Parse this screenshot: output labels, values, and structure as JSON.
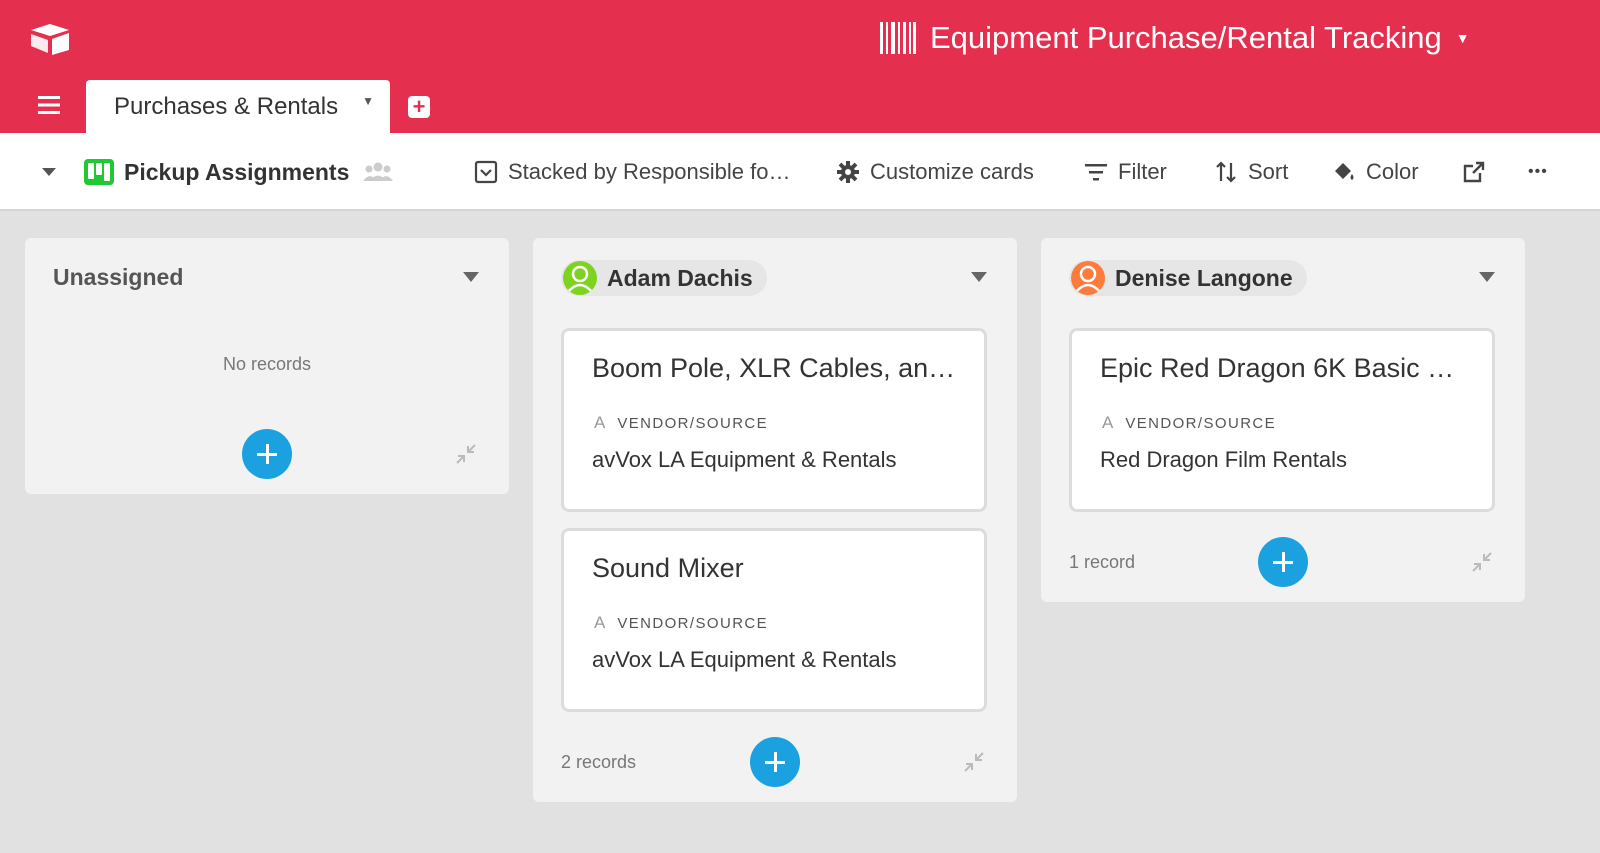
{
  "app": {
    "base_title": "Equipment Purchase/Rental Tracking",
    "brand_color": "#e52f4f"
  },
  "tabs": [
    {
      "label": "Purchases & Rentals",
      "active": true
    }
  ],
  "viewbar": {
    "view_name": "Pickup Assignments",
    "stacked_by": "Stacked by Responsible fo…",
    "customize": "Customize cards",
    "filter": "Filter",
    "sort": "Sort",
    "color": "Color",
    "more": "•••"
  },
  "columns": [
    {
      "title": "Unassigned",
      "empty_text": "No records",
      "cards": []
    },
    {
      "title": "Adam Dachis",
      "avatar_color": "#7ed321",
      "count_text": "2 records",
      "cards": [
        {
          "title": "Boom Pole, XLR Cables, an…",
          "field_label": "VENDOR/SOURCE",
          "field_value": "avVox LA Equipment & Rentals"
        },
        {
          "title": "Sound Mixer",
          "field_label": "VENDOR/SOURCE",
          "field_value": "avVox LA Equipment & Rentals"
        }
      ]
    },
    {
      "title": "Denise Langone",
      "avatar_color": "#ff7a3d",
      "count_text": "1 record",
      "cards": [
        {
          "title": "Epic Red Dragon 6K Basic …",
          "field_label": "VENDOR/SOURCE",
          "field_value": "Red Dragon Film Rentals"
        }
      ]
    }
  ],
  "accent_color": "#1ba0e0"
}
